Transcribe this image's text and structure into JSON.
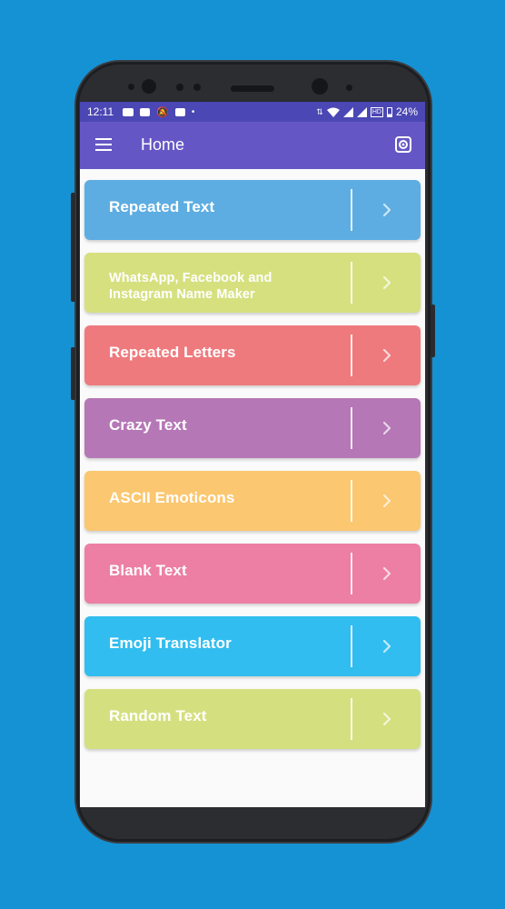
{
  "status_bar": {
    "time": "12:11",
    "battery": "24%"
  },
  "app_bar": {
    "title": "Home",
    "menu_icon": "hamburger-menu-icon",
    "settings_icon": "settings-gear-icon"
  },
  "items": [
    {
      "label": "Repeated Text",
      "color": "#5dade2"
    },
    {
      "label": "WhatsApp, Facebook and Instagram Name Maker",
      "color": "#d6e07f"
    },
    {
      "label": "Repeated Letters",
      "color": "#ef7a7d"
    },
    {
      "label": "Crazy Text",
      "color": "#b577b6"
    },
    {
      "label": "ASCII Emoticons",
      "color": "#fbc770"
    },
    {
      "label": "Blank Text",
      "color": "#ec7fa3"
    },
    {
      "label": "Emoji Translator",
      "color": "#31bdef"
    },
    {
      "label": "Random Text",
      "color": "#d4e07f"
    }
  ]
}
